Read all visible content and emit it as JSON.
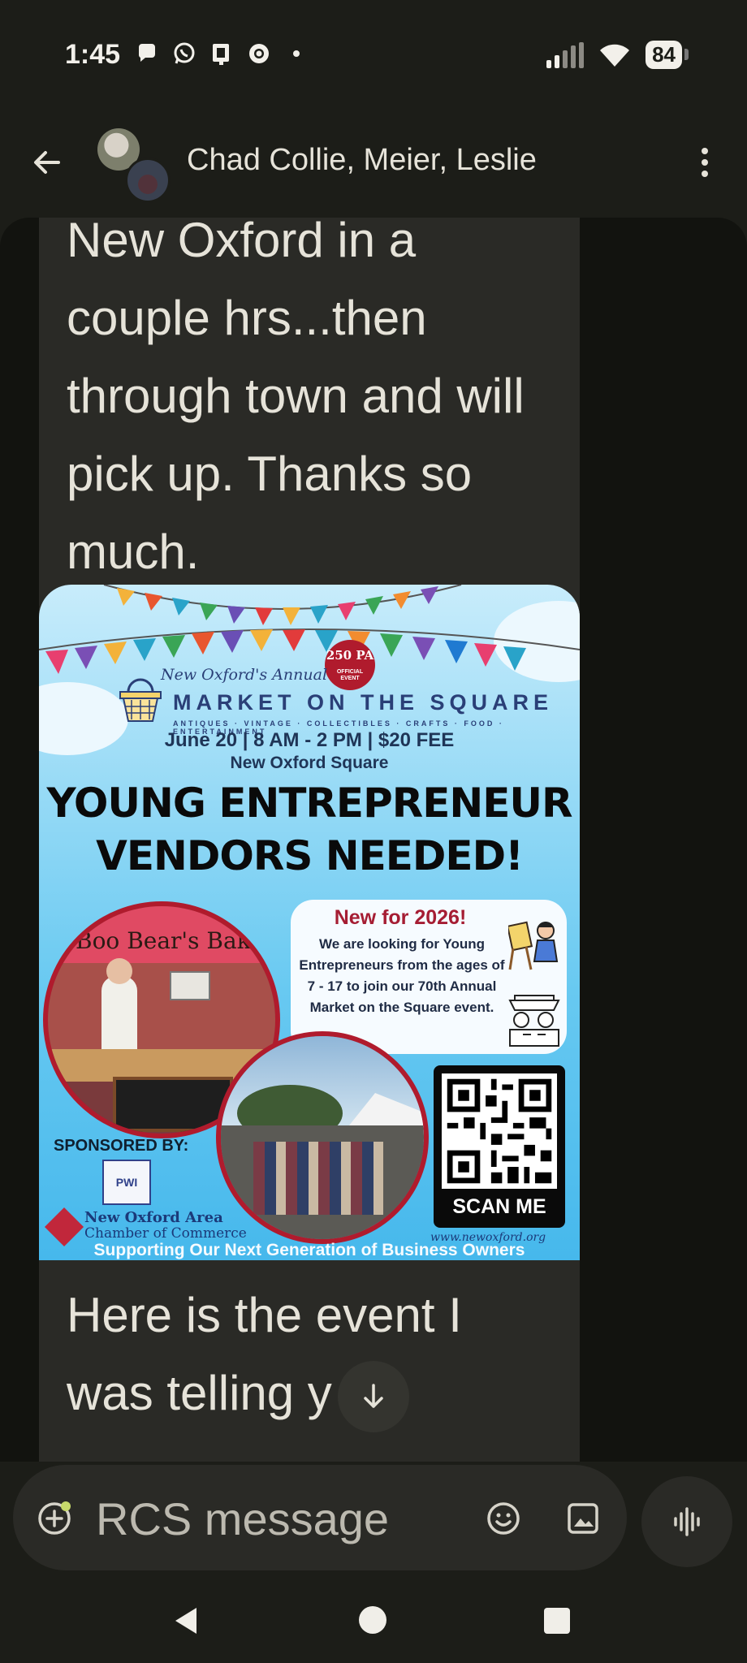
{
  "status_bar": {
    "time": "1:45",
    "notification_icons": [
      "chat-bubble-icon",
      "whatsapp-icon",
      "tablet-notification-icon",
      "chrome-icon",
      "dot-icon"
    ],
    "battery": "84"
  },
  "app_bar": {
    "title": "Chad Collie, Meier, Leslie"
  },
  "messages": [
    {
      "type": "text",
      "text": "New Oxford in a couple hrs...then through town and will pick up. Thanks so much."
    },
    {
      "type": "image",
      "flyer": {
        "annual": "New Oxford's Annual",
        "market": "MARKET ON THE SQUARE",
        "categories": "ANTIQUES · VINTAGE · COLLECTIBLES · CRAFTS · FOOD · ENTERTAINMENT",
        "badge": "250 PA",
        "badge_sub": "OFFICIAL EVENT",
        "date_line": "June 20 | 8 AM - 2 PM | $20 FEE",
        "location": "New Oxford Square",
        "headline_1": "YOUNG ENTREPRENEUR",
        "headline_2": "VENDORS NEEDED!",
        "new_title": "New for 2026!",
        "new_body": "We are looking for Young Entrepreneurs from the ages of 7 - 17 to join our 70th Annual Market on the Square event.",
        "booth_sign": "Boo Bear's Bake",
        "sponsored_by": "SPONSORED BY:",
        "sponsor_logo": "PWI",
        "chamber_line1": "New Oxford Area",
        "chamber_line2": "Chamber of Commerce",
        "scan_me": "SCAN ME",
        "website": "www.newoxford.org",
        "footer": "Supporting Our Next Generation of Business Owners"
      }
    },
    {
      "type": "text",
      "text": "Here is the event I was telling y"
    }
  ],
  "compose": {
    "placeholder": "RCS message"
  }
}
